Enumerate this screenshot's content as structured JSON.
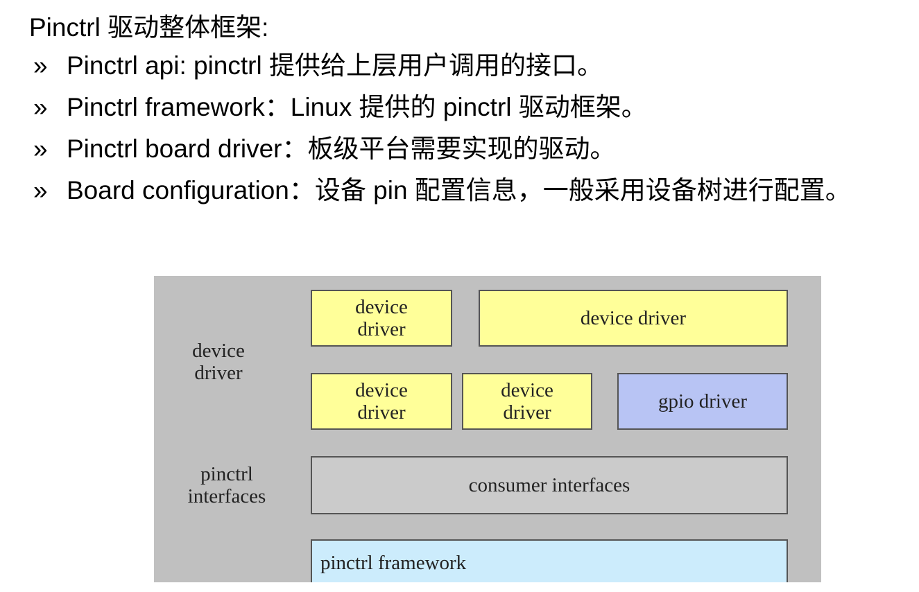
{
  "heading": "Pinctrl 驱动整体框架:",
  "bullet_mark": "»",
  "bullets": [
    "Pinctrl api: pinctrl 提供给上层用户调用的接口。",
    "Pinctrl framework：Linux 提供的 pinctrl 驱动框架。",
    "Pinctrl board driver：板级平台需要实现的驱动。",
    "Board configuration：设备 pin 配置信息，一般采用设备树进行配置。"
  ],
  "diagram": {
    "labels": {
      "device_driver_line1": "device",
      "device_driver_line2": "driver",
      "pinctrl_interfaces_line1": "pinctrl",
      "pinctrl_interfaces_line2": "interfaces"
    },
    "boxes": {
      "top_left_line1": "device",
      "top_left_line2": "driver",
      "top_right": "device driver",
      "mid_left_line1": "device",
      "mid_left_line2": "driver",
      "mid_center_line1": "device",
      "mid_center_line2": "driver",
      "gpio_driver": "gpio driver",
      "consumer_interfaces": "consumer interfaces",
      "pinctrl_framework": "pinctrl framework"
    },
    "colors": {
      "background": "#c0c0c0",
      "device_driver": "#ffff99",
      "gpio_driver": "#b8c4f4",
      "consumer_interfaces": "#cbcbcb",
      "pinctrl_framework": "#ccecfc"
    }
  }
}
